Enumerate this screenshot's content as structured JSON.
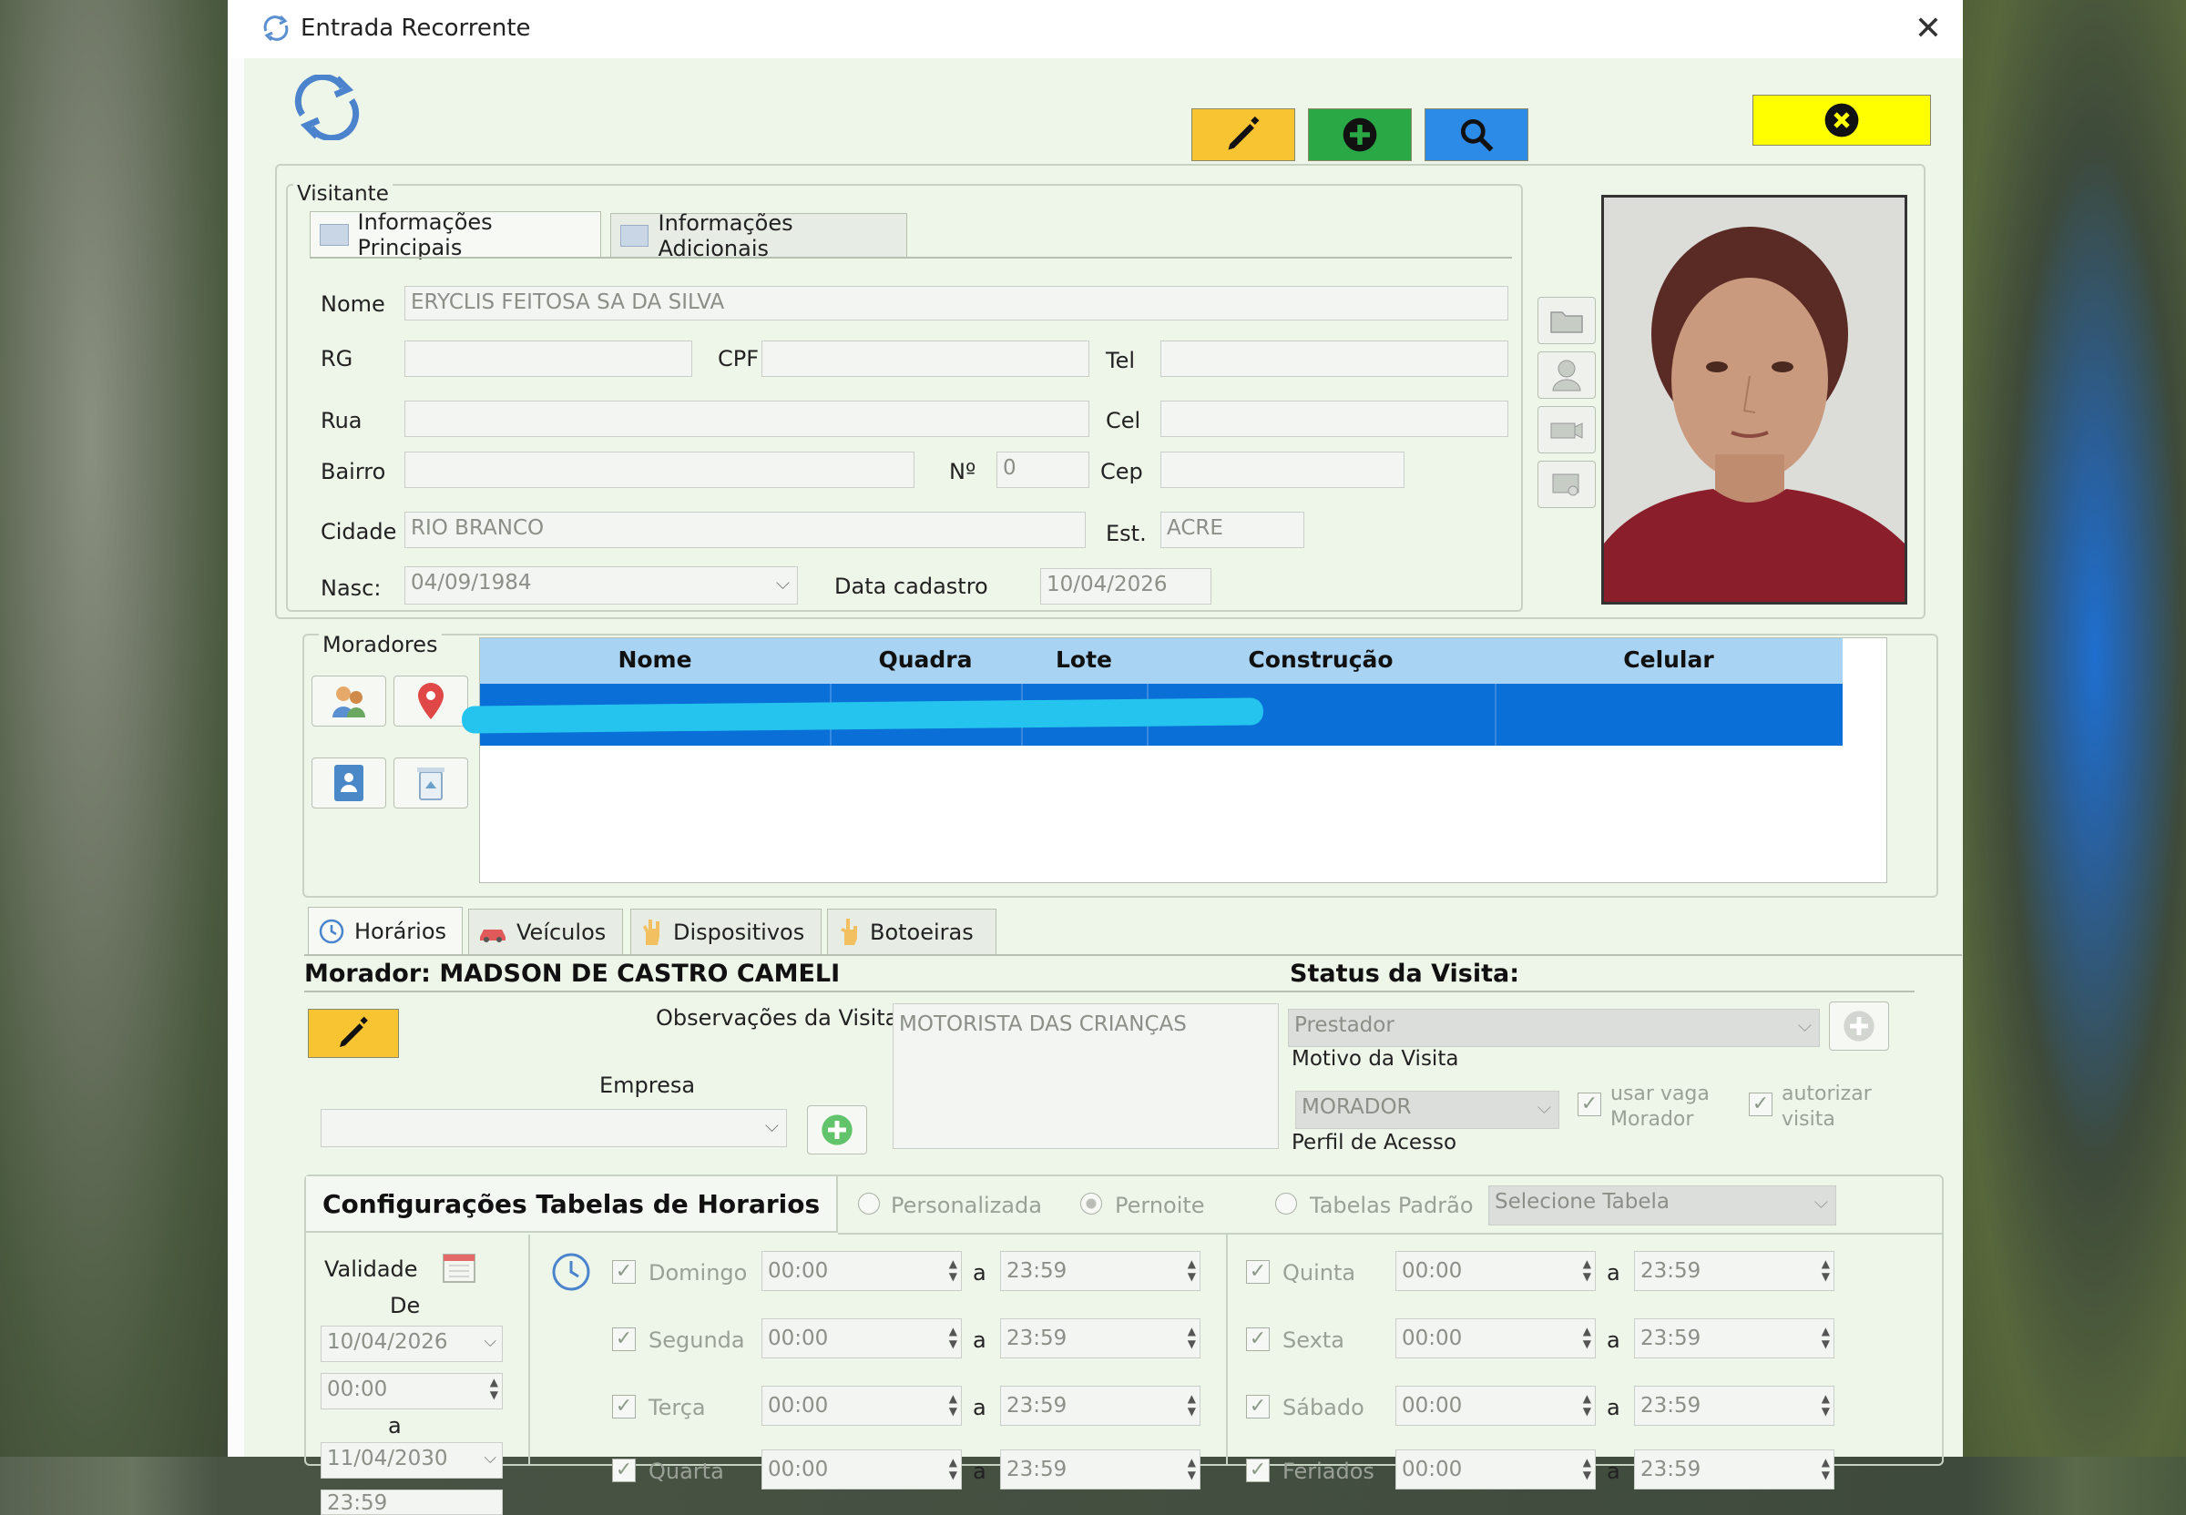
{
  "window": {
    "title": "Entrada Recorrente"
  },
  "colors": {
    "edit_btn": "#f8c432",
    "add_btn": "#2aa845",
    "search_btn": "#2d8be8",
    "exit_btn": "#ffff00",
    "grid_header": "#a9d3f2",
    "grid_row": "#0a6fd6"
  },
  "visitante": {
    "group_label": "Visitante",
    "tabs": [
      "Informações Principais",
      "Informações Adicionais"
    ],
    "fields": {
      "nome_label": "Nome",
      "nome": "ERYCLIS FEITOSA SA DA SILVA",
      "rg_label": "RG",
      "cpf_label": "CPF",
      "tel_label": "Tel",
      "rua_label": "Rua",
      "cel_label": "Cel",
      "bairro_label": "Bairro",
      "numero_label": "Nº",
      "numero": "0",
      "cep_label": "Cep",
      "cidade_label": "Cidade",
      "cidade": "RIO BRANCO",
      "est_label": "Est.",
      "est": "ACRE",
      "nasc_label": "Nasc:",
      "nasc": "04/09/1984",
      "data_cadastro_label": "Data cadastro",
      "data_cadastro": "10/04/2026"
    }
  },
  "moradores": {
    "group_label": "Moradores",
    "columns": [
      "Nome",
      "Quadra",
      "Lote",
      "Construção",
      "Celular"
    ]
  },
  "bottom_tabs": [
    "Horários",
    "Veículos",
    "Dispositivos",
    "Botoeiras"
  ],
  "morador": {
    "title": "Morador: MADSON DE CASTRO CAMELI",
    "obs_label": "Observações da Visita:",
    "obs_value": "MOTORISTA DAS CRIANÇAS",
    "empresa_label": "Empresa"
  },
  "status": {
    "title": "Status da Visita:",
    "motivo_value": "Prestador",
    "motivo_label": "Motivo da Visita",
    "perfil_value": "MORADOR",
    "perfil_label": "Perfil de Acesso",
    "usar_vaga": "usar vaga Morador",
    "autorizar": "autorizar visita"
  },
  "config": {
    "title": "Configurações Tabelas de Horarios",
    "radio_personalizada": "Personalizada",
    "radio_pernoite": "Pernoite",
    "radio_tabelas": "Tabelas Padrão",
    "tabela_placeholder": "Selecione Tabela",
    "validade_label": "Validade",
    "de_label": "De",
    "de_date": "10/04/2026",
    "de_time": "00:00",
    "a_label": "a",
    "ate_date": "11/04/2030",
    "ate_time": "23:59",
    "days_left": [
      {
        "day": "Domingo",
        "from": "00:00",
        "to": "23:59"
      },
      {
        "day": "Segunda",
        "from": "00:00",
        "to": "23:59"
      },
      {
        "day": "Terça",
        "from": "00:00",
        "to": "23:59"
      },
      {
        "day": "Quarta",
        "from": "00:00",
        "to": "23:59"
      }
    ],
    "days_right": [
      {
        "day": "Quinta",
        "from": "00:00",
        "to": "23:59"
      },
      {
        "day": "Sexta",
        "from": "00:00",
        "to": "23:59"
      },
      {
        "day": "Sábado",
        "from": "00:00",
        "to": "23:59"
      },
      {
        "day": "Feriados",
        "from": "00:00",
        "to": "23:59"
      }
    ]
  }
}
